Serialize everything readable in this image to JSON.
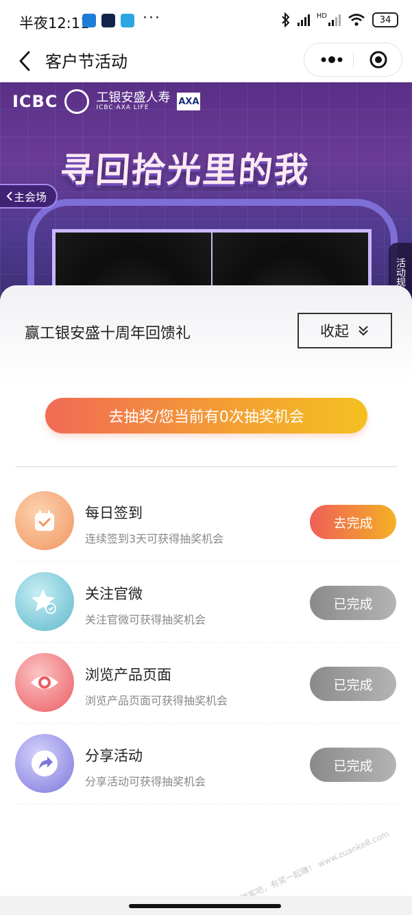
{
  "status_bar": {
    "time": "半夜12:11",
    "more": "···",
    "battery": "34",
    "hd": "HD"
  },
  "nav": {
    "title": "客户节活动"
  },
  "banner": {
    "brand_icbc": "ICBC",
    "brand_cn": "工银安盛人寿",
    "brand_en": "ICBC·AXA LIFE",
    "brand_axa": "AXA",
    "headline": "寻回拾光里的我",
    "main_venue": "主会场",
    "rules": "活动规"
  },
  "sheet": {
    "title": "赢工银安盛十周年回馈礼",
    "collapse_label": "收起",
    "lottery_label": "去抽奖/您当前有0次抽奖机会",
    "tasks": [
      {
        "name": "每日签到",
        "desc": "连续签到3天可获得抽奖机会",
        "action": "去完成",
        "status": "todo",
        "icon": "calendar-check-icon",
        "color": "#f4a06a"
      },
      {
        "name": "关注官微",
        "desc": "关注官微可获得抽奖机会",
        "action": "已完成",
        "status": "done",
        "icon": "star-check-icon",
        "color": "#6ec6d8"
      },
      {
        "name": "浏览产品页面",
        "desc": "浏览产品页面可获得抽奖机会",
        "action": "已完成",
        "status": "done",
        "icon": "eye-icon",
        "color": "#ef6d72"
      },
      {
        "name": "分享活动",
        "desc": "分享活动可获得抽奖机会",
        "action": "已完成",
        "status": "done",
        "icon": "share-arrow-icon",
        "color": "#8b86e4"
      }
    ]
  },
  "watermark": "赚客吧，有奖一起赚！ www.zuanke8.com"
}
